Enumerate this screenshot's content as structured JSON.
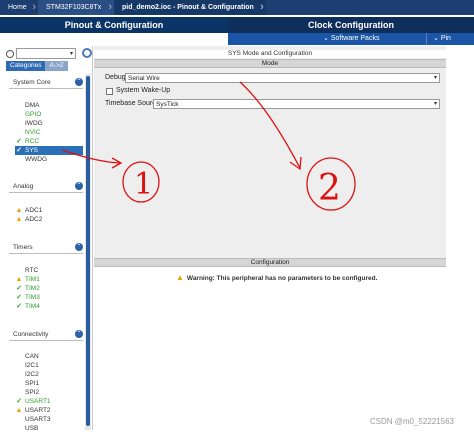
{
  "breadcrumb": [
    "Home",
    "STM32F103C8Tx",
    "pid_demo2.ioc - Pinout & Configuration"
  ],
  "tabs": {
    "pinout": "Pinout & Configuration",
    "clock": "Clock Configuration"
  },
  "subbar": {
    "software_packs": "Software Packs",
    "pinout_more": "Pin"
  },
  "left": {
    "category_tabs": [
      "Categories",
      "A->Z"
    ],
    "groups": {
      "system_core": "System Core",
      "analog": "Analog",
      "timers": "Timers",
      "connectivity": "Connectivity"
    },
    "system_core_items": [
      "DMA",
      "GPIO",
      "IWDG",
      "NVIC",
      "RCC",
      "SYS",
      "WWDG"
    ],
    "analog_items": [
      "ADC1",
      "ADC2"
    ],
    "timers_items": [
      "RTC",
      "TIM1",
      "TIM2",
      "TIM3",
      "TIM4"
    ],
    "connectivity_items": [
      "CAN",
      "I2C1",
      "I2C2",
      "SPI1",
      "SPI2",
      "USART1",
      "USART2",
      "USART3",
      "USB"
    ]
  },
  "center": {
    "title": "SYS Mode and Configuration",
    "mode_header": "Mode",
    "debug_label": "Debug",
    "debug_value": "Serial Wire",
    "system_wakeup_label": "System Wake-Up",
    "timebase_label": "Timebase Source",
    "timebase_value": "SysTick",
    "config_header": "Configuration",
    "warning": "Warning: This peripheral has no parameters to be configured."
  },
  "annotations": [
    "1",
    "2"
  ],
  "watermark": "CSDN @m0_52221563",
  "colors": {
    "nav_dark": "#0b3466",
    "accent_blue": "#1a56a5",
    "enabled_green": "#2ca02c",
    "annotation_red": "#d11",
    "warning_yellow": "#e8a400"
  }
}
